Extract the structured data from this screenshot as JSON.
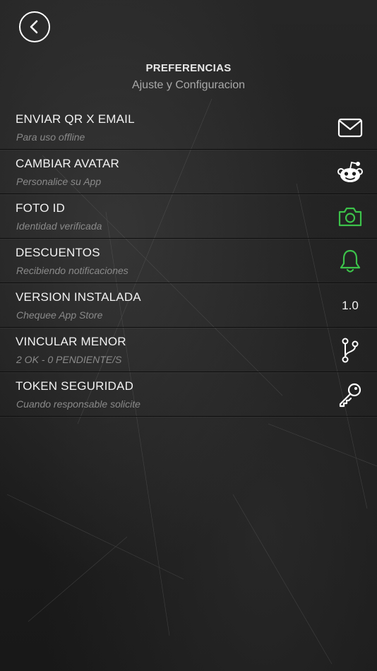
{
  "header": {
    "title": "PREFERENCIAS",
    "subtitle": "Ajuste y Configuracion"
  },
  "colors": {
    "accent_green": "#3cc24a",
    "text_primary": "#f2f2f2",
    "text_secondary": "#8a8a8a"
  },
  "items": [
    {
      "label": "ENVIAR QR X EMAIL",
      "sub": "Para uso offline",
      "icon": "mail-icon"
    },
    {
      "label": "CAMBIAR AVATAR",
      "sub": "Personalice su App",
      "icon": "reddit-alien-icon"
    },
    {
      "label": "FOTO ID",
      "sub": "Identidad verificada",
      "icon": "camera-icon"
    },
    {
      "label": "DESCUENTOS",
      "sub": "Recibiendo notificaciones",
      "icon": "bell-icon"
    },
    {
      "label": "VERSION INSTALADA",
      "sub": "Chequee App Store",
      "value": "1.0"
    },
    {
      "label": "VINCULAR MENOR",
      "sub": "2 OK - 0 PENDIENTE/S",
      "icon": "git-branch-icon"
    },
    {
      "label": "TOKEN SEGURIDAD",
      "sub": "Cuando responsable solicite",
      "icon": "key-icon"
    }
  ]
}
